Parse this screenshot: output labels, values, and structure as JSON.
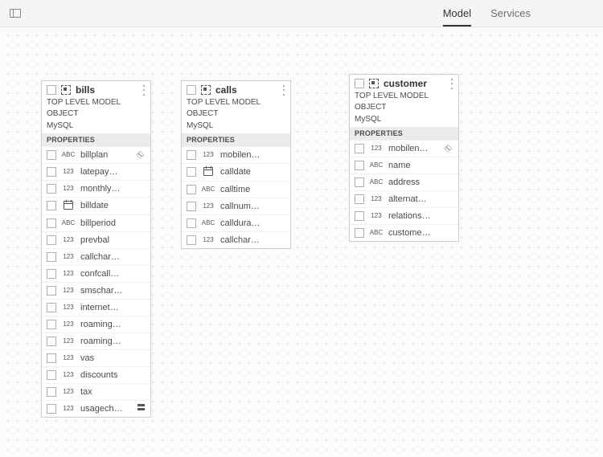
{
  "tabs": {
    "model": "Model",
    "services": "Services"
  },
  "panels": {
    "bills": {
      "title": "bills",
      "toplabel": "TOP LEVEL MODEL OBJECT",
      "source": "MySQL",
      "props_header": "PROPERTIES",
      "props": [
        {
          "type": "ABC",
          "name": "billplan",
          "key": true
        },
        {
          "type": "123",
          "name": "latepay…"
        },
        {
          "type": "123",
          "name": "monthly…"
        },
        {
          "type": "DATE",
          "name": "billdate"
        },
        {
          "type": "ABC",
          "name": "billperiod"
        },
        {
          "type": "123",
          "name": "prevbal"
        },
        {
          "type": "123",
          "name": "callchar…"
        },
        {
          "type": "123",
          "name": "confcall…"
        },
        {
          "type": "123",
          "name": "smschar…"
        },
        {
          "type": "123",
          "name": "internet…"
        },
        {
          "type": "123",
          "name": "roaming…"
        },
        {
          "type": "123",
          "name": "roaming…"
        },
        {
          "type": "123",
          "name": "vas"
        },
        {
          "type": "123",
          "name": "discounts"
        },
        {
          "type": "123",
          "name": "tax"
        },
        {
          "type": "123",
          "name": "usagech…",
          "computed": true
        }
      ]
    },
    "calls": {
      "title": "calls",
      "toplabel": "TOP LEVEL MODEL OBJECT",
      "source": "MySQL",
      "props_header": "PROPERTIES",
      "props": [
        {
          "type": "123",
          "name": "mobilen…"
        },
        {
          "type": "DATE",
          "name": "calldate"
        },
        {
          "type": "ABC",
          "name": "calltime"
        },
        {
          "type": "123",
          "name": "callnum…"
        },
        {
          "type": "ABC",
          "name": "calldura…"
        },
        {
          "type": "123",
          "name": "callchar…"
        }
      ]
    },
    "customer": {
      "title": "customer",
      "toplabel": "TOP LEVEL MODEL OBJECT",
      "source": "MySQL",
      "props_header": "PROPERTIES",
      "props": [
        {
          "type": "123",
          "name": "mobilen…",
          "key": true
        },
        {
          "type": "ABC",
          "name": "name"
        },
        {
          "type": "ABC",
          "name": "address"
        },
        {
          "type": "123",
          "name": "alternat…"
        },
        {
          "type": "123",
          "name": "relations…"
        },
        {
          "type": "ABC",
          "name": "custome…"
        }
      ]
    }
  }
}
